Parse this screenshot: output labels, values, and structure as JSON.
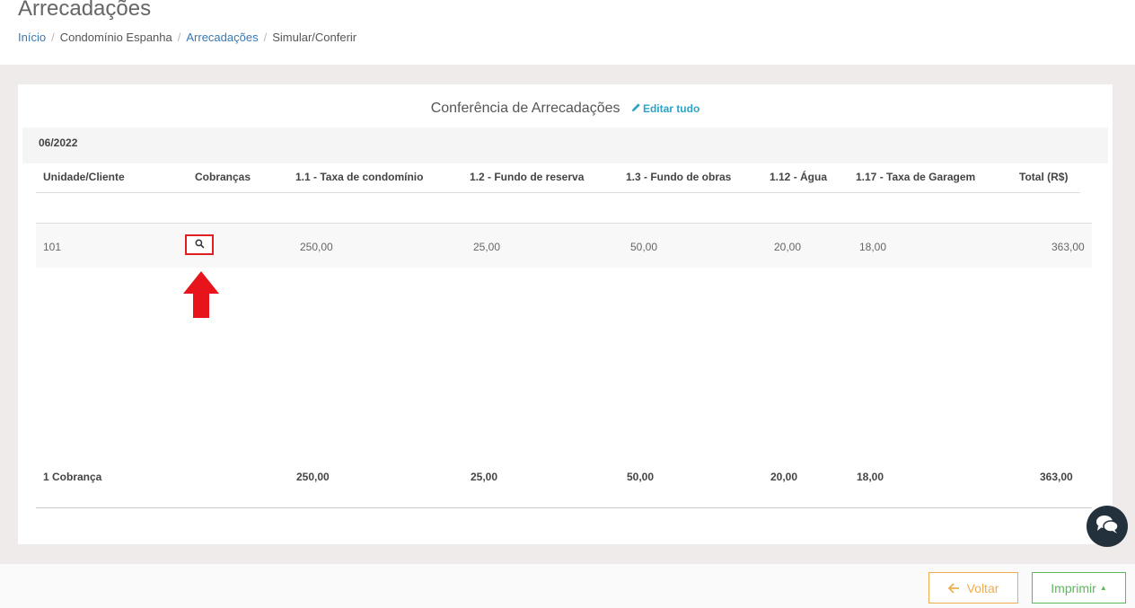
{
  "header": {
    "title": "Arrecadações",
    "breadcrumb": [
      "Início",
      "Condomínio Espanha",
      "Arrecadações",
      "Simular/Conferir"
    ]
  },
  "panel": {
    "title": "Conferência de Arrecadações",
    "edit_all": "Editar tudo",
    "period": "06/2022"
  },
  "table": {
    "headers": [
      "Unidade/Cliente",
      "Cobranças",
      "1.1 - Taxa de condomínio",
      "1.2 - Fundo de reserva",
      "1.3 - Fundo de obras",
      "1.12 - Água",
      "1.17 - Taxa de Garagem",
      "Total (R$)"
    ],
    "rows": [
      {
        "unit": "101",
        "cells": [
          "250,00",
          "25,00",
          "50,00",
          "20,00",
          "18,00",
          "363,00"
        ]
      }
    ],
    "totals": {
      "label": "1 Cobrança",
      "cells": [
        "250,00",
        "25,00",
        "50,00",
        "20,00",
        "18,00",
        "363,00"
      ]
    }
  },
  "footer": {
    "back_label": "Voltar",
    "print_label": "Imprimir"
  },
  "icons": {
    "search": "search-icon",
    "edit": "pencil-icon",
    "chat": "chat-icon",
    "back": "arrow-left-icon",
    "caret": "caret-up-icon"
  },
  "colors": {
    "link": "#3a78b5",
    "edit_link": "#2ba4c8",
    "back_button": "#f0ad4e",
    "print_button": "#5cb85c",
    "annotation": "#e02020",
    "chat_button": "#23313d"
  }
}
